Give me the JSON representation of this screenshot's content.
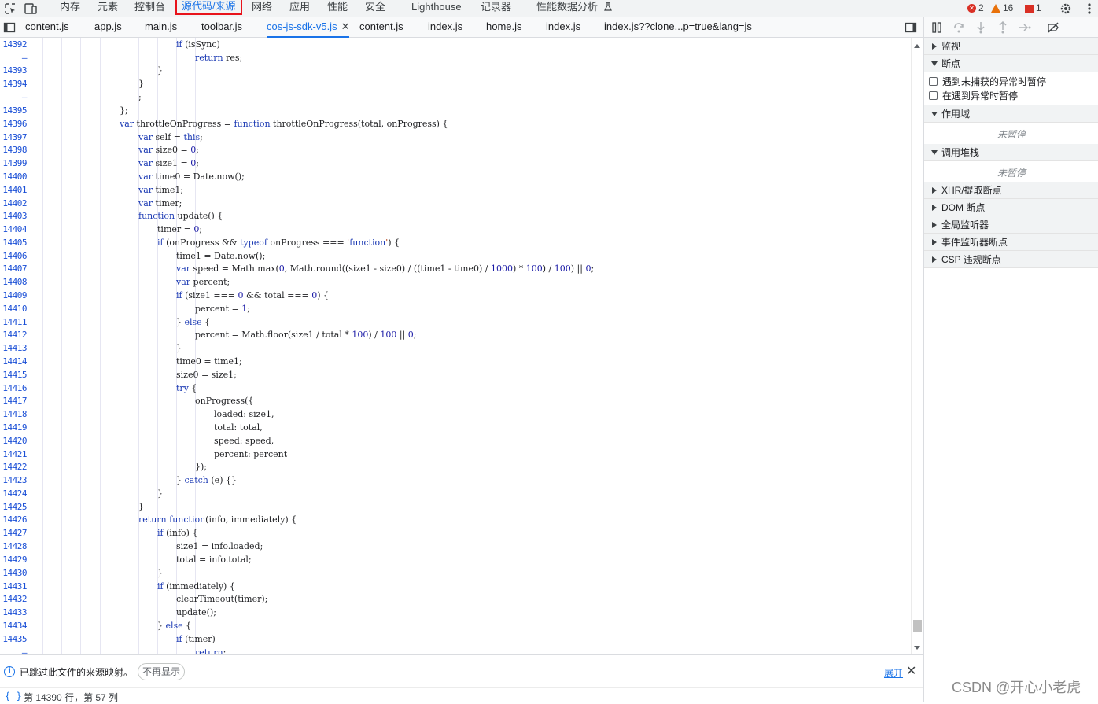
{
  "topbar": {
    "tabs": [
      "内存",
      "元素",
      "控制台",
      "源代码/来源",
      "网络",
      "应用",
      "性能",
      "安全",
      "Lighthouse",
      "记录器",
      "性能数据分析"
    ],
    "issues": {
      "errors": "2",
      "warnings": "16",
      "info": "1"
    }
  },
  "file_tabs": [
    "content.js",
    "app.js",
    "main.js",
    "toolbar.js",
    "cos-js-sdk-v5.js",
    "content.js",
    "index.js",
    "home.js",
    "index.js",
    "index.js??clone...p=true&lang=js"
  ],
  "close_glyph": "✕",
  "code_lines": [
    {
      "n": "14392",
      "c": "if (isSync)"
    },
    {
      "n": "–",
      "c": "return res;"
    },
    {
      "n": "14393",
      "c": "}"
    },
    {
      "n": "14394",
      "c": "}"
    },
    {
      "n": "–",
      "c": ";"
    },
    {
      "n": "14395",
      "c": "};"
    },
    {
      "n": "14396",
      "c": "var throttleOnProgress = function throttleOnProgress(total, onProgress) {"
    },
    {
      "n": "14397",
      "c": "var self = this;"
    },
    {
      "n": "14398",
      "c": "var size0 = 0;"
    },
    {
      "n": "14399",
      "c": "var size1 = 0;"
    },
    {
      "n": "14400",
      "c": "var time0 = Date.now();"
    },
    {
      "n": "14401",
      "c": "var time1;"
    },
    {
      "n": "14402",
      "c": "var timer;"
    },
    {
      "n": "14403",
      "c": "function update() {"
    },
    {
      "n": "14404",
      "c": "timer = 0;"
    },
    {
      "n": "14405",
      "c": "if (onProgress && typeof onProgress === 'function') {"
    },
    {
      "n": "14406",
      "c": "time1 = Date.now();"
    },
    {
      "n": "14407",
      "c": "var speed = Math.max(0, Math.round((size1 - size0) / ((time1 - time0) / 1000) * 100) / 100) || 0;"
    },
    {
      "n": "14408",
      "c": "var percent;"
    },
    {
      "n": "14409",
      "c": "if (size1 === 0 && total === 0) {"
    },
    {
      "n": "14410",
      "c": "percent = 1;"
    },
    {
      "n": "14411",
      "c": "} else {"
    },
    {
      "n": "14412",
      "c": "percent = Math.floor(size1 / total * 100) / 100 || 0;"
    },
    {
      "n": "14413",
      "c": "}"
    },
    {
      "n": "14414",
      "c": "time0 = time1;"
    },
    {
      "n": "14415",
      "c": "size0 = size1;"
    },
    {
      "n": "14416",
      "c": "try {"
    },
    {
      "n": "14417",
      "c": "onProgress({"
    },
    {
      "n": "14418",
      "c": "loaded: size1,"
    },
    {
      "n": "14419",
      "c": "total: total,"
    },
    {
      "n": "14420",
      "c": "speed: speed,"
    },
    {
      "n": "14421",
      "c": "percent: percent"
    },
    {
      "n": "14422",
      "c": "});"
    },
    {
      "n": "14423",
      "c": "} catch (e) {}"
    },
    {
      "n": "14424",
      "c": "}"
    },
    {
      "n": "14425",
      "c": "}"
    },
    {
      "n": "14426",
      "c": "return function(info, immediately) {"
    },
    {
      "n": "14427",
      "c": "if (info) {"
    },
    {
      "n": "14428",
      "c": "size1 = info.loaded;"
    },
    {
      "n": "14429",
      "c": "total = info.total;"
    },
    {
      "n": "14430",
      "c": "}"
    },
    {
      "n": "14431",
      "c": "if (immediately) {"
    },
    {
      "n": "14432",
      "c": "clearTimeout(timer);"
    },
    {
      "n": "14433",
      "c": "update();"
    },
    {
      "n": "14434",
      "c": "} else {"
    },
    {
      "n": "14435",
      "c": "if (timer)"
    },
    {
      "n": "–",
      "c": "return;"
    }
  ],
  "right_panel": {
    "watch": "监视",
    "breakpoints": "断点",
    "pause_uncaught": "遇到未捕获的异常时暂停",
    "pause_caught": "在遇到异常时暂停",
    "scope": "作用域",
    "not_paused_1": "未暂停",
    "call_stack": "调用堆栈",
    "not_paused_2": "未暂停",
    "xhr": "XHR/提取断点",
    "dom": "DOM 断点",
    "global": "全局监听器",
    "event": "事件监听器断点",
    "csp": "CSP 违规断点"
  },
  "infobar": {
    "message": "已跳过此文件的来源映射。",
    "dont_show": "不再显示",
    "expand": "展开"
  },
  "statusbar": {
    "braces": "{ }",
    "position": "第 14390 行，第 57 列"
  },
  "watermark": "CSDN @开心小老虎"
}
